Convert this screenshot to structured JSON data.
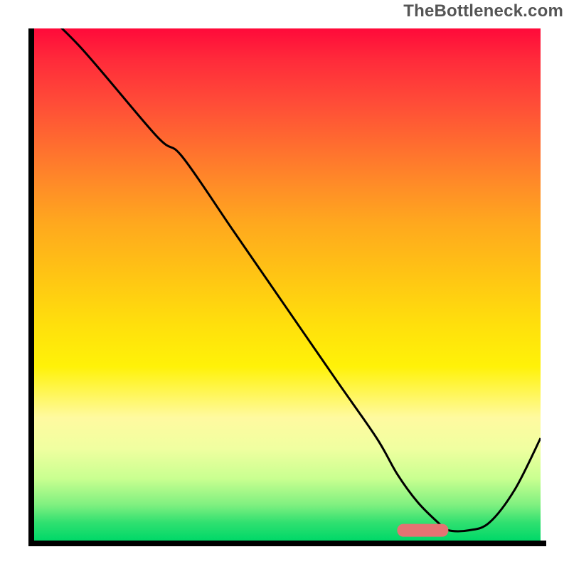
{
  "watermark": "TheBottleneck.com",
  "chart_data": {
    "type": "line",
    "title": "",
    "xlabel": "",
    "ylabel": "",
    "xlim": [
      0,
      100
    ],
    "ylim": [
      0,
      100
    ],
    "grid": false,
    "legend": null,
    "series": [
      {
        "name": "curve",
        "x": [
          0,
          10,
          25,
          30,
          40,
          50,
          60,
          68,
          72,
          76,
          80,
          82,
          86,
          90,
          95,
          100
        ],
        "values": [
          106,
          96.5,
          79,
          75,
          60.5,
          46,
          31.5,
          20,
          13,
          7.5,
          3.5,
          2,
          2,
          3.5,
          10,
          20
        ]
      }
    ],
    "marker": {
      "x_start": 72,
      "x_end": 82,
      "y": 2,
      "color": "#e57373",
      "thickness": 2.5
    },
    "gradient_stops": [
      {
        "pos": 0,
        "color": "#ff0a3a"
      },
      {
        "pos": 6,
        "color": "#ff2a3a"
      },
      {
        "pos": 14,
        "color": "#ff4a38"
      },
      {
        "pos": 22,
        "color": "#ff6a30"
      },
      {
        "pos": 30,
        "color": "#ff8a28"
      },
      {
        "pos": 38,
        "color": "#ffa81e"
      },
      {
        "pos": 48,
        "color": "#ffc414"
      },
      {
        "pos": 58,
        "color": "#ffe00c"
      },
      {
        "pos": 66,
        "color": "#fff208"
      },
      {
        "pos": 76,
        "color": "#fffaa0"
      },
      {
        "pos": 82,
        "color": "#f0ffa0"
      },
      {
        "pos": 88,
        "color": "#c8ff90"
      },
      {
        "pos": 93,
        "color": "#80f080"
      },
      {
        "pos": 96.5,
        "color": "#30e070"
      },
      {
        "pos": 100,
        "color": "#00d868"
      }
    ]
  }
}
